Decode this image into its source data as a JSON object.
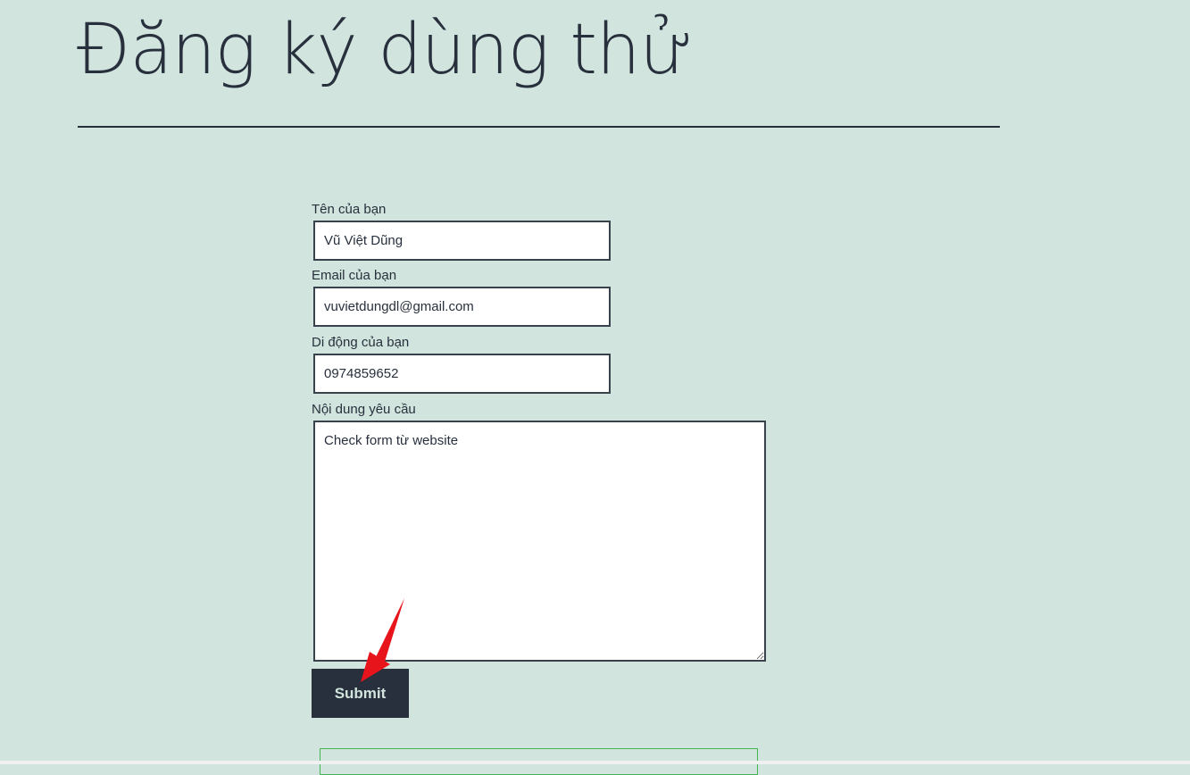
{
  "page": {
    "title": "Đăng ký dùng thử"
  },
  "form": {
    "name": {
      "label": "Tên của bạn",
      "value": "Vũ Việt Dũng"
    },
    "email": {
      "label": "Email của bạn",
      "value": "vuvietdungdl@gmail.com"
    },
    "phone": {
      "label": "Di động của bạn",
      "value": "0974859652"
    },
    "message": {
      "label": "Nội dung yêu cầu",
      "value": "Check form từ website"
    },
    "submit_label": "Submit"
  },
  "colors": {
    "background": "#d1e4dd",
    "text": "#28303d",
    "button": "#28303d",
    "button_text": "#d1e4dd",
    "annotation_arrow": "#e8141b",
    "response_border": "#46b450"
  }
}
